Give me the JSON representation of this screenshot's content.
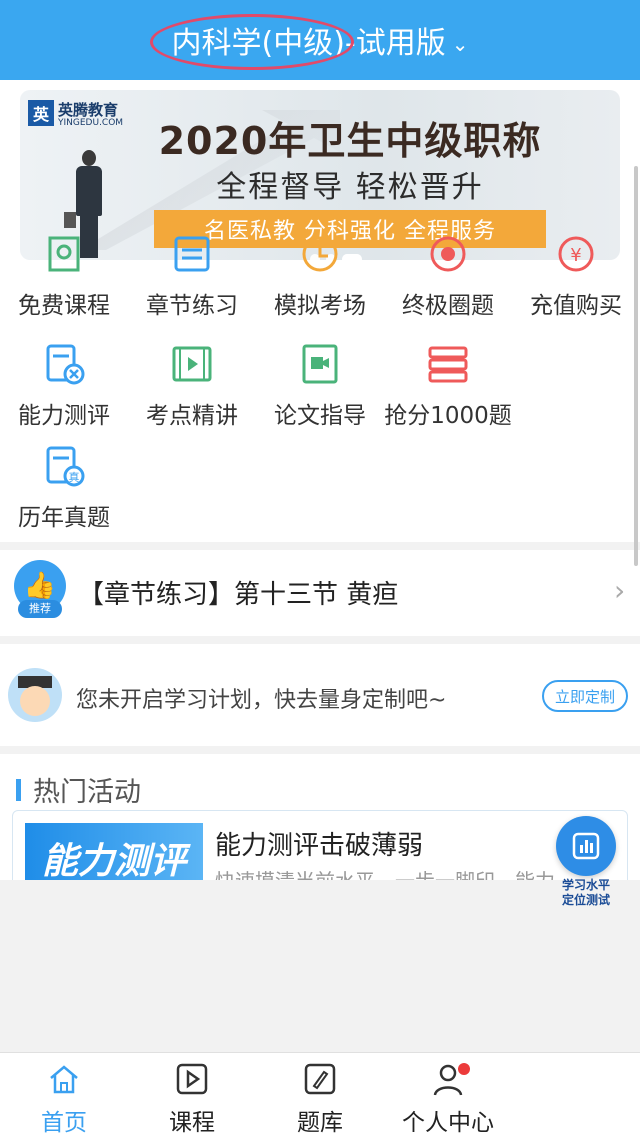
{
  "header": {
    "title": "内科学(中级)-试用版",
    "caret": "⌄"
  },
  "banner": {
    "brand": "英腾教育",
    "brand_url": "YINGEDU.COM",
    "brand_mark": "英",
    "headline": "2020年卫生中级职称",
    "subline": "全程督导  轻松晋升",
    "bar_text": "名医私教  分科强化  全程服务"
  },
  "grid": {
    "items": [
      {
        "label": "免费课程",
        "icon": "book-icon"
      },
      {
        "label": "章节练习",
        "icon": "list-icon"
      },
      {
        "label": "模拟考场",
        "icon": "clock-icon"
      },
      {
        "label": "终极圈题",
        "icon": "target-icon"
      },
      {
        "label": "充值购买",
        "icon": "yen-icon"
      },
      {
        "label": "能力测评",
        "icon": "test-icon"
      },
      {
        "label": "考点精讲",
        "icon": "video-icon"
      },
      {
        "label": "论文指导",
        "icon": "camera-book-icon"
      },
      {
        "label": "抢分1000题",
        "icon": "stack-icon"
      },
      {
        "label": "历年真题",
        "icon": "real-exam-icon"
      }
    ]
  },
  "recommend": {
    "tag": "推荐",
    "text": "【章节练习】第十三节 黄疸",
    "chevron": "›"
  },
  "plan": {
    "text": "您未开启学习计划，快去量身定制吧~",
    "button": "立即定制"
  },
  "hot": {
    "title": "热门活动",
    "activity": {
      "image_text": "能力测评",
      "title": "能力测评击破薄弱",
      "subtitle": "快速摸清当前水平，一步一脚印，能力"
    }
  },
  "float": {
    "label_line1": "学习水平",
    "label_line2": "定位测试"
  },
  "tabs": [
    {
      "label": "首页",
      "active": true
    },
    {
      "label": "课程",
      "active": false
    },
    {
      "label": "题库",
      "active": false
    },
    {
      "label": "个人中心",
      "active": false,
      "badge": true
    }
  ],
  "colors": {
    "primary": "#3aa7f0",
    "accent_orange": "#f3a83a",
    "badge_red": "#ec3b3b",
    "oval_red": "#e14a6a"
  }
}
